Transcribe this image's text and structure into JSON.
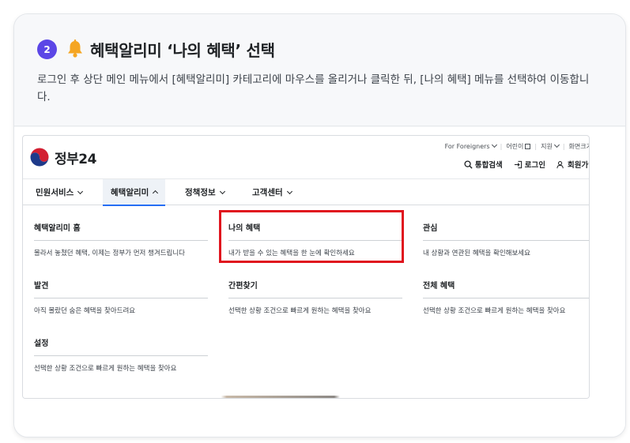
{
  "step": {
    "number": "2",
    "title": "혜택알리미 ‘나의 혜택’ 선택",
    "description": "로그인 후 상단 메인 메뉴에서 [혜택알리미] 카테고리에 마우스를 올리거나 클릭한 뒤, [나의 혜택] 메뉴를 선택하여 이동합니다."
  },
  "site": {
    "logo_text": "정부",
    "logo_num": "24",
    "utility": [
      "For Foreigners",
      "어린이",
      "지원",
      "화면크기"
    ],
    "actions": [
      "통합검색",
      "로그인",
      "회원가입"
    ],
    "nav": [
      "민원서비스",
      "혜택알리미",
      "정책정보",
      "고객센터"
    ],
    "menu": [
      {
        "title": "혜택알리미 홈",
        "desc": "몰라서 놓쳤던 혜택, 이제는 정부가 먼저 챙겨드립니다"
      },
      {
        "title": "나의 혜택",
        "desc": "내가 받을 수 있는 혜택을 한 눈에 확인하세요"
      },
      {
        "title": "관심",
        "desc": "내 상황과 연관된 혜택을 확인해보세요"
      },
      {
        "title": "발견",
        "desc": "아직 몰랐던 숨은 혜택을 찾아드려요"
      },
      {
        "title": "간편찾기",
        "desc": "선택한 상황 조건으로 빠르게 원하는 혜택을 찾아요"
      },
      {
        "title": "전체 혜택",
        "desc": "선택한 상황 조건으로 빠르게 원하는 혜택을 찾아요"
      },
      {
        "title": "설정",
        "desc": "선택한 상황 조건으로 빠르게 원하는 혜택을 찾아요"
      }
    ]
  },
  "colors": {
    "badge": "#5b46e6",
    "bell": "#f5a623",
    "highlight": "#e0141e",
    "nav_active": "#256ef4"
  },
  "icons": [
    "bell-icon",
    "search-icon",
    "login-icon",
    "user-add-icon",
    "external-link-icon",
    "chevron-down-icon",
    "chevron-up-icon"
  ]
}
